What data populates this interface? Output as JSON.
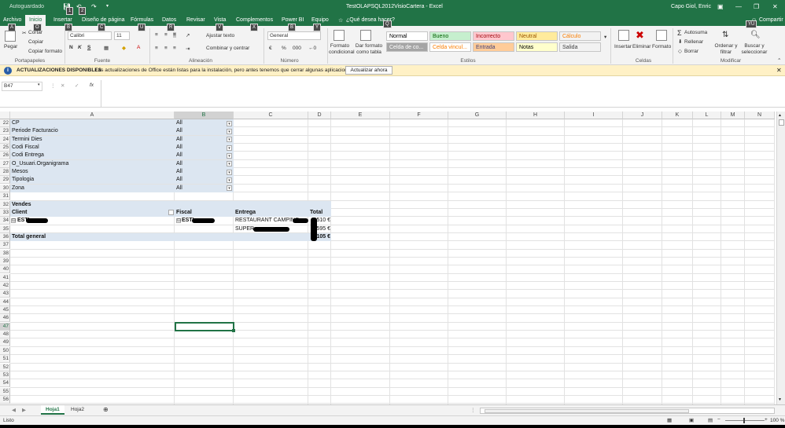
{
  "title_bar": {
    "autosave": "Autoguardado",
    "qa_badges": [
      "1",
      "2",
      "3"
    ],
    "document_title": "TestOLAPSQL2012VisioCartera - Excel",
    "user": "Capo Giol, Enric"
  },
  "tabs": [
    "Archivo",
    "Inicio",
    "Insertar",
    "Diseño de página",
    "Fórmulas",
    "Datos",
    "Revisar",
    "Vista",
    "Complementos",
    "Power BI",
    "Equipo"
  ],
  "tell_me": "¿Qué desea hacer?",
  "share": "Compartir",
  "keytips": [
    "A",
    "O",
    "B",
    "C",
    "U",
    "R",
    "V",
    "X",
    "B",
    "Y",
    "Q",
    "YU"
  ],
  "ribbon": {
    "paste": "Pegar",
    "cut": "Cortar",
    "copy": "Copiar",
    "format_painter": "Copiar formato",
    "font_name": "Calibri",
    "font_size": "11",
    "bold": "N",
    "italic": "K",
    "underline": "S",
    "wrap_text": "Ajustar texto",
    "merge_center": "Combinar y centrar",
    "number_format": "General",
    "conditional_formatting": "Formato condicional",
    "format_as_table": "Dar formato como tabla",
    "styles": [
      {
        "label": "Normal",
        "bg": "#ffffff",
        "fg": "#000000"
      },
      {
        "label": "Bueno",
        "bg": "#c6efce",
        "fg": "#006100"
      },
      {
        "label": "Incorrecto",
        "bg": "#ffc7ce",
        "fg": "#9c0006"
      },
      {
        "label": "Neutral",
        "bg": "#ffeb9c",
        "fg": "#9c5700"
      },
      {
        "label": "Cálculo",
        "bg": "#f2f2f2",
        "fg": "#fa7d00"
      },
      {
        "label": "Celda de co...",
        "bg": "#a5a5a5",
        "fg": "#ffffff"
      },
      {
        "label": "Celda vincul...",
        "bg": "#ffffff",
        "fg": "#fa7d00"
      },
      {
        "label": "Entrada",
        "bg": "#ffcc99",
        "fg": "#3f3f76"
      },
      {
        "label": "Notas",
        "bg": "#ffffcc",
        "fg": "#000000"
      },
      {
        "label": "Salida",
        "bg": "#f2f2f2",
        "fg": "#3f3f3f"
      }
    ],
    "insert": "Insertar",
    "delete": "Eliminar",
    "format": "Formato",
    "autosum": "Autosuma",
    "fill": "Rellenar",
    "clear": "Borrar",
    "sort_filter": "Ordenar y filtrar",
    "find_select": "Buscar y seleccionar",
    "groups": [
      "Portapapeles",
      "Fuente",
      "Alineación",
      "Número",
      "Estilos",
      "Celdas",
      "Modificar"
    ]
  },
  "notice": {
    "title": "ACTUALIZACIONES DISPONIBLES",
    "message": "Las actualizaciones de Office están listas para la instalación, pero antes tenemos que cerrar algunas aplicaciones.",
    "button": "Actualizar ahora"
  },
  "formula_bar": {
    "name_box": "B47",
    "fx": "fx",
    "value": ""
  },
  "columns": [
    "A",
    "B",
    "C",
    "D",
    "E",
    "F",
    "G",
    "H",
    "I",
    "J",
    "K",
    "L",
    "M",
    "N"
  ],
  "rows": [
    "22",
    "23",
    "24",
    "25",
    "26",
    "27",
    "28",
    "29",
    "30",
    "31",
    "32",
    "33",
    "34",
    "35",
    "36",
    "37",
    "38",
    "39",
    "40",
    "41",
    "42",
    "43",
    "44",
    "45",
    "46",
    "47",
    "48",
    "49",
    "50",
    "51",
    "52",
    "53",
    "54",
    "55",
    "56"
  ],
  "filters": [
    {
      "field": "CP",
      "value": "All"
    },
    {
      "field": "Periode Facturacio",
      "value": "All"
    },
    {
      "field": "Termini Dies",
      "value": "All"
    },
    {
      "field": "Codi Fiscal",
      "value": "All"
    },
    {
      "field": "Codi Entrega",
      "value": "All"
    },
    {
      "field": "O_Usuari.Organigrama",
      "value": "All"
    },
    {
      "field": "Mesos",
      "value": "All"
    },
    {
      "field": "Tipologia",
      "value": "All"
    },
    {
      "field": "Zona",
      "value": ""
    }
  ],
  "pivot": {
    "measure": "Vendes",
    "headers": [
      "Client",
      "Fiscal",
      "Entrega",
      "Total"
    ],
    "client": "ESTI",
    "fiscal": "ESTI",
    "entrega_1": "RESTAURANT CAMPING",
    "entrega_2": "SUPER",
    "total_1": "510 €",
    "total_2": "595 €",
    "grand_label": "Total general",
    "grand_total": "105 €"
  },
  "sheets": [
    "Hoja1",
    "Hoja2"
  ],
  "status": {
    "ready": "Listo",
    "zoom": "100 %"
  }
}
